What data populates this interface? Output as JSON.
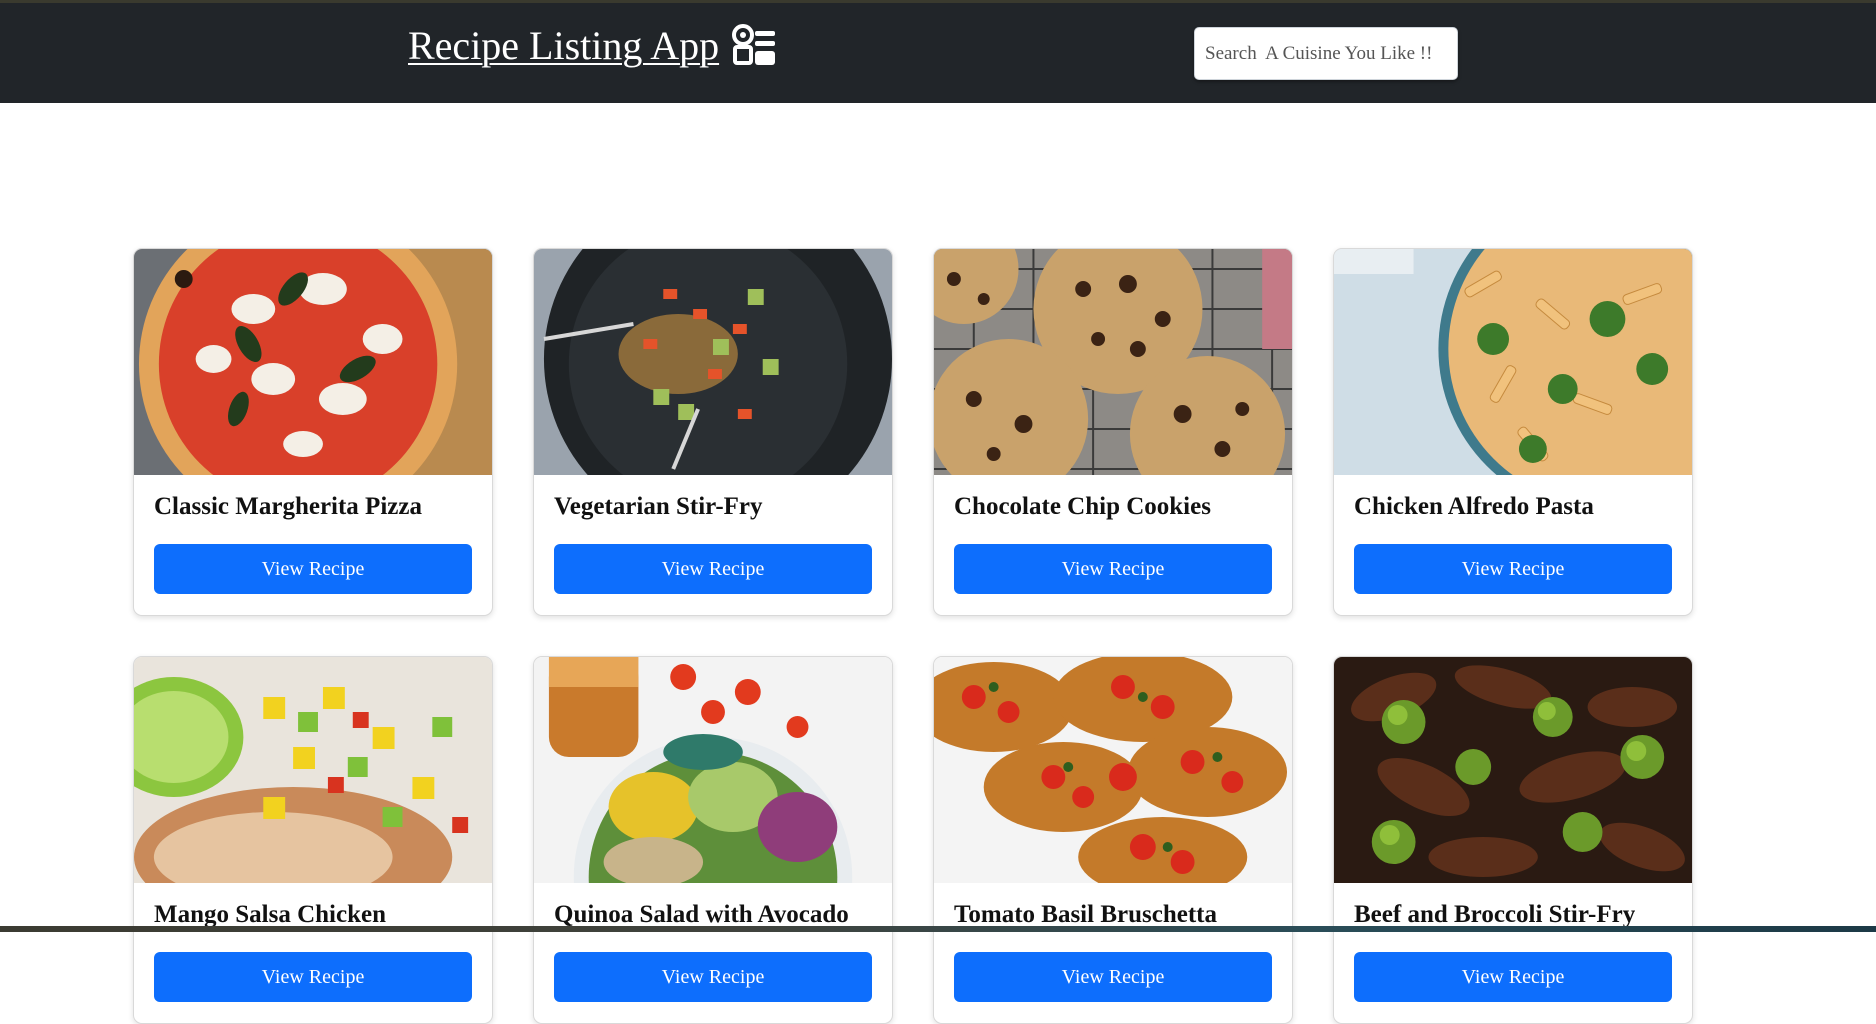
{
  "header": {
    "title": "Recipe Listing App",
    "logo_icon": "chef-utensils-icon"
  },
  "search": {
    "placeholder": "Search  A Cuisine You Like !!",
    "value": ""
  },
  "colors": {
    "navbar": "#212529",
    "button": "#0d6efd"
  },
  "recipes": [
    {
      "title": "Classic Margherita Pizza",
      "button": "View Recipe",
      "image": "pizza-image"
    },
    {
      "title": "Vegetarian Stir-Fry",
      "button": "View Recipe",
      "image": "stir-fry-image"
    },
    {
      "title": "Chocolate Chip Cookies",
      "button": "View Recipe",
      "image": "cookies-image"
    },
    {
      "title": "Chicken Alfredo Pasta",
      "button": "View Recipe",
      "image": "pasta-image"
    },
    {
      "title": "Mango Salsa Chicken",
      "button": "View Recipe",
      "image": "mango-chicken-image"
    },
    {
      "title": "Quinoa Salad with Avocado",
      "button": "View Recipe",
      "image": "quinoa-salad-image"
    },
    {
      "title": "Tomato Basil Bruschetta",
      "button": "View Recipe",
      "image": "bruschetta-image"
    },
    {
      "title": "Beef and Broccoli Stir-Fry",
      "button": "View Recipe",
      "image": "beef-broccoli-image"
    }
  ]
}
